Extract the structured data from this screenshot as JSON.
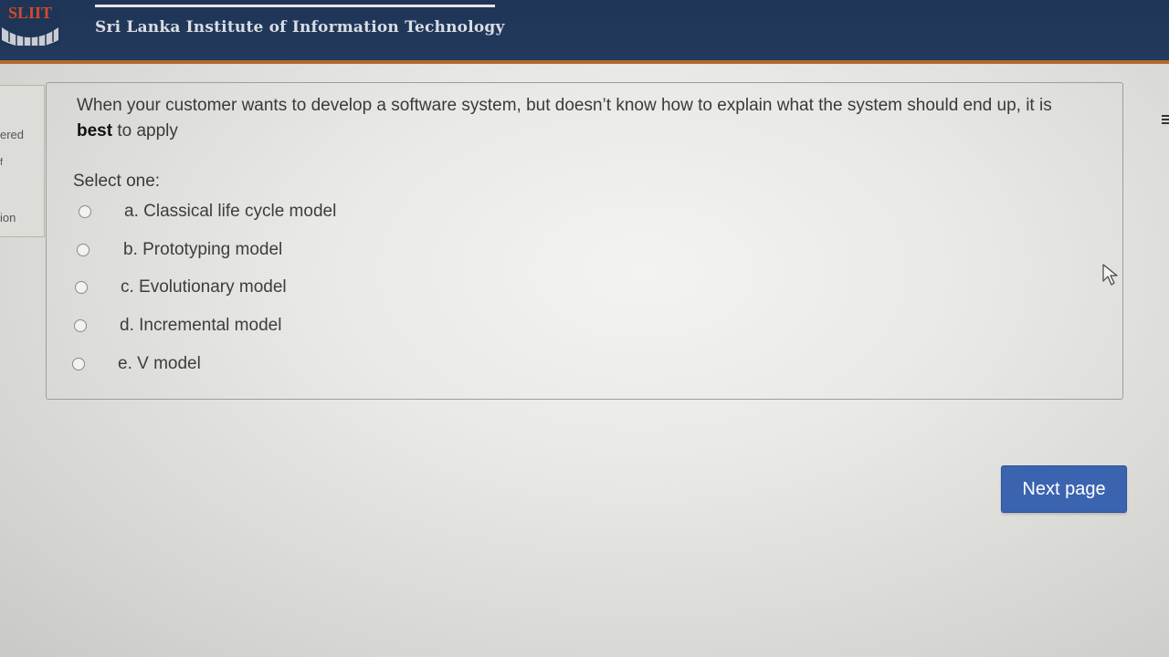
{
  "header": {
    "logo_text": "SLIIT",
    "institution_name": "Sri Lanka Institute of Information Technology"
  },
  "sidebar": {
    "fragments": [
      "ered",
      "f",
      "ion"
    ]
  },
  "question": {
    "text_before_bold": "When your customer wants to develop a software system, but doesn’t know how to explain what the system should end up, it is ",
    "bold_word": "best",
    "text_after_bold": " to apply",
    "select_label": "Select one:",
    "options": [
      {
        "label": "a. Classical life cycle model",
        "selected": false
      },
      {
        "label": "b. Prototyping model",
        "selected": false
      },
      {
        "label": "c. Evolutionary model",
        "selected": false
      },
      {
        "label": "d. Incremental model",
        "selected": false
      },
      {
        "label": "e. V model",
        "selected": false
      }
    ]
  },
  "navigation": {
    "next_label": "Next page"
  },
  "colors": {
    "header_bg": "#1f3557",
    "header_accent": "#b36a2e",
    "button_bg": "#3b64b0"
  },
  "icons": [
    "logo-icon",
    "radio-icon",
    "mouse-cursor-icon"
  ]
}
